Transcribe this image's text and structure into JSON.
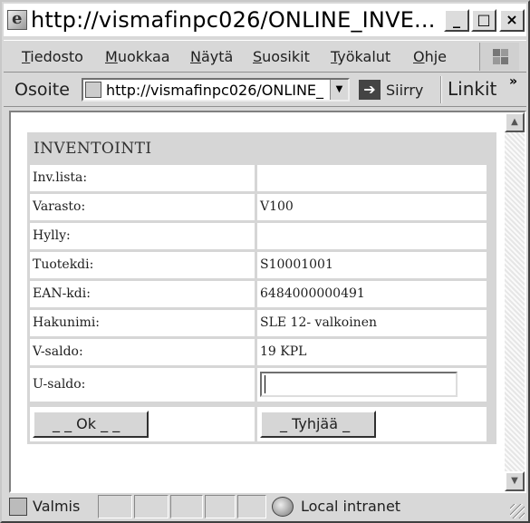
{
  "window": {
    "title": "http://vismafinpc026/ONLINE_INVE...",
    "minimize": "_",
    "maximize": "□",
    "close": "×"
  },
  "menu": {
    "items": [
      "Tiedosto",
      "Muokkaa",
      "Näytä",
      "Suosikit",
      "Työkalut",
      "Ohje"
    ]
  },
  "address": {
    "label": "Osoite",
    "url": "http://vismafinpc026/ONLINE_",
    "go_label": "Siirry",
    "links_label": "Linkit",
    "links_chevron": "»"
  },
  "form": {
    "title": "INVENTOINTI",
    "rows": [
      {
        "label": "Inv.lista:",
        "value": ""
      },
      {
        "label": "Varasto:",
        "value": "V100"
      },
      {
        "label": "Hylly:",
        "value": ""
      },
      {
        "label": "Tuotekdi:",
        "value": "S10001001"
      },
      {
        "label": "EAN-kdi:",
        "value": "6484000000491"
      },
      {
        "label": "Hakunimi:",
        "value": "SLE 12- valkoinen"
      },
      {
        "label": "V-saldo:",
        "value": "19 KPL"
      }
    ],
    "usaldo": {
      "label": "U-saldo:",
      "value": ""
    },
    "ok_button": "_ _ Ok _ _",
    "clear_button": "_ Tyhjää _"
  },
  "status": {
    "text": "Valmis",
    "zone": "Local intranet"
  }
}
